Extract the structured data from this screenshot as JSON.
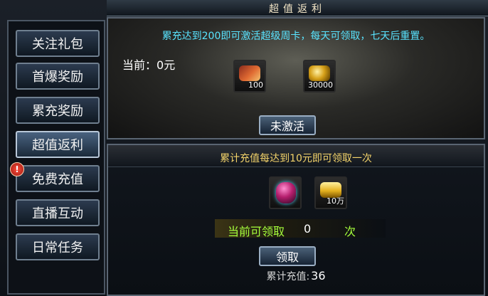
{
  "window": {
    "title": "超值返利"
  },
  "sidebar": {
    "items": [
      {
        "label": "关注礼包",
        "active": false,
        "alert": false
      },
      {
        "label": "首爆奖励",
        "active": false,
        "alert": false
      },
      {
        "label": "累充奖励",
        "active": false,
        "alert": false
      },
      {
        "label": "超值返利",
        "active": true,
        "alert": false
      },
      {
        "label": "免费充值",
        "active": false,
        "alert": true
      },
      {
        "label": "直播互动",
        "active": false,
        "alert": false
      },
      {
        "label": "日常任务",
        "active": false,
        "alert": false
      }
    ],
    "alert_icon": "exclamation-icon"
  },
  "top_panel": {
    "banner": "累充达到200即可激活超级周卡，每天可领取，七天后重置。",
    "current_label": "当前：",
    "current_value": "0元",
    "rewards": [
      {
        "icon": "book-bundle-icon",
        "count": "100"
      },
      {
        "icon": "gold-coins-icon",
        "count": "30000"
      }
    ],
    "status_button": "未激活"
  },
  "bottom_panel": {
    "title": "累计充值每达到10元即可领取一次",
    "rewards": [
      {
        "icon": "treasure-bag-icon",
        "count": ""
      },
      {
        "icon": "gold-ingot-icon",
        "count": "10万"
      }
    ],
    "claimable_label": "当前可领取",
    "claimable_value": "0",
    "claimable_unit": "次",
    "claim_button": "领取",
    "total_label": "累计充值:",
    "total_value": "36"
  },
  "colors": {
    "banner_cyan": "#59e4ff",
    "title_gold": "#f3d36a",
    "claim_green": "#a6ff3c",
    "button_border": "#9aaec3"
  }
}
